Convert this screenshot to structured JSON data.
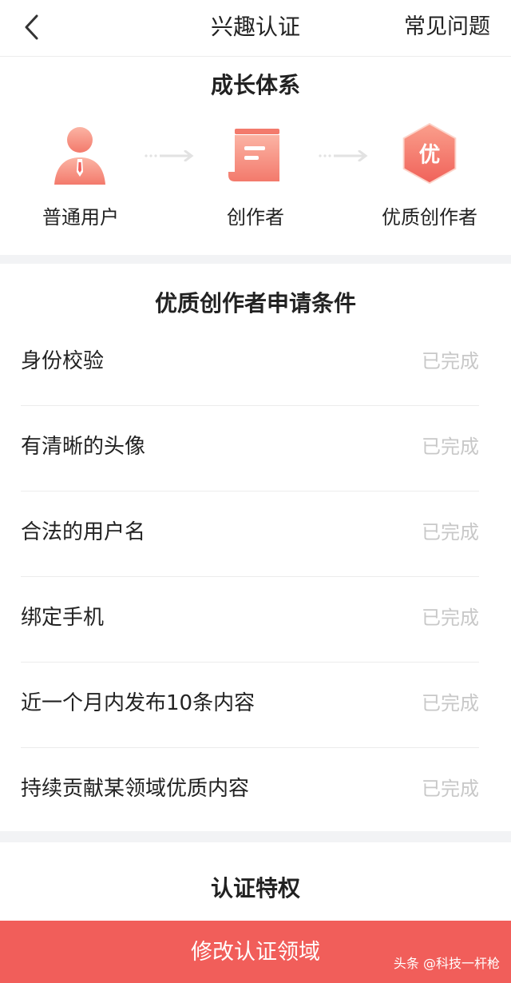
{
  "nav": {
    "title": "兴趣认证",
    "faq_label": "常见问题",
    "back_icon": "chevron-left-icon"
  },
  "growth": {
    "title": "成长体系",
    "steps": [
      {
        "label": "普通用户",
        "icon": "user-icon"
      },
      {
        "label": "创作者",
        "icon": "document-icon"
      },
      {
        "label": "优质创作者",
        "icon": "premium-badge-icon",
        "badge": "优"
      }
    ],
    "colors": {
      "accent": "#f15e5a",
      "icon_light": "#f9a595",
      "arrow": "#e2e2e2"
    }
  },
  "conditions": {
    "title": "优质创作者申请条件",
    "items": [
      {
        "label": "身份校验",
        "status": "已完成"
      },
      {
        "label": "有清晰的头像",
        "status": "已完成"
      },
      {
        "label": "合法的用户名",
        "status": "已完成"
      },
      {
        "label": "绑定手机",
        "status": "已完成"
      },
      {
        "label": "近一个月内发布10条内容",
        "status": "已完成"
      },
      {
        "label": "持续贡献某领域优质内容",
        "status": "已完成"
      }
    ]
  },
  "privileges": {
    "title": "认证特权"
  },
  "cta": {
    "label": "修改认证领域"
  },
  "watermark": {
    "text": "头条 @科技一杆枪"
  }
}
